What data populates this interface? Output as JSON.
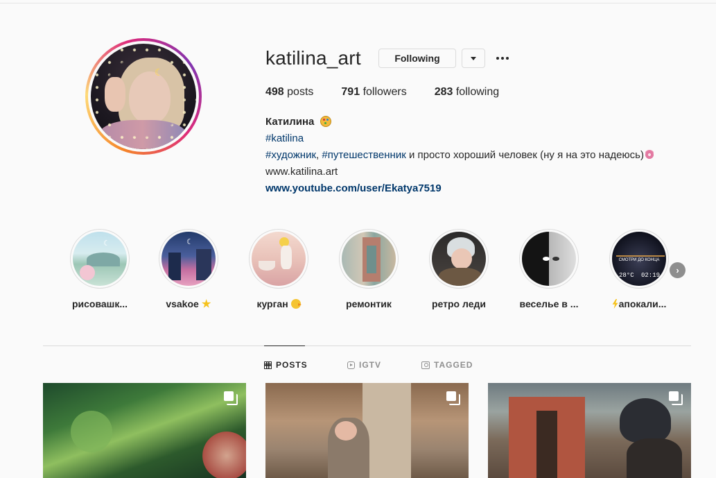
{
  "profile": {
    "username": "katilina_art",
    "following_label": "Following",
    "stats": {
      "posts_count": "498",
      "posts_label": "posts",
      "followers_count": "791",
      "followers_label": "followers",
      "following_count": "283",
      "following_label": "following"
    },
    "bio": {
      "name": "Катилина",
      "hashtag1": "#katilina",
      "tag2": "#художник",
      "sep": ", ",
      "tag3": "#путешественник",
      "line3_rest": " и просто хороший человек (ну я на это надеюсь)",
      "website": "www.katilina.art",
      "youtube": "www.youtube.com/user/Ekatya7519"
    }
  },
  "highlights": [
    {
      "label": "рисовашк...",
      "icon": "none"
    },
    {
      "label": "vsakoe ",
      "icon": "star-icon"
    },
    {
      "label": "курган ",
      "icon": "chick-icon"
    },
    {
      "label": "ремонтик",
      "icon": "none"
    },
    {
      "label": "ретро леди",
      "icon": "none"
    },
    {
      "label": "веселье в ...",
      "icon": "none"
    },
    {
      "label": "апокали...",
      "icon": "lightning-icon"
    }
  ],
  "highlight_overlay": {
    "line1": "СМОТРИ ДО КОНЦА",
    "temp": "28°C",
    "time": "02:19"
  },
  "tabs": {
    "posts": "POSTS",
    "igtv": "IGTV",
    "tagged": "TAGGED"
  },
  "colors": {
    "link": "#00376b",
    "text": "#262626",
    "muted": "#8e8e8e",
    "border": "#dbdbdb",
    "background": "#fafafa"
  }
}
